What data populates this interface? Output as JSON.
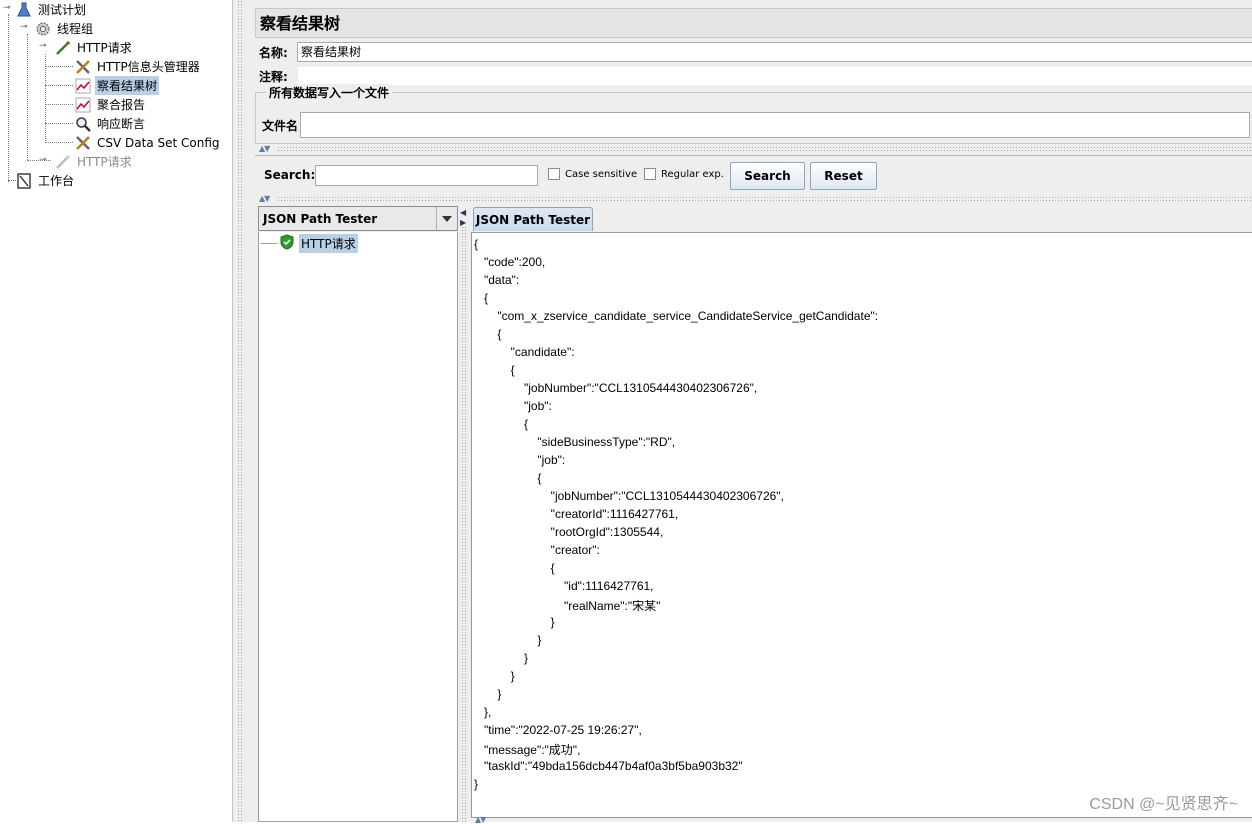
{
  "tree": {
    "nodes": [
      {
        "label": "测试计划",
        "icon": "flask-icon"
      },
      {
        "label": "线程组",
        "icon": "gear-icon"
      },
      {
        "label": "HTTP请求",
        "icon": "pipette-icon"
      },
      {
        "label": "HTTP信息头管理器",
        "icon": "wrench-icon"
      },
      {
        "label": "察看结果树",
        "icon": "graph-icon"
      },
      {
        "label": "聚合报告",
        "icon": "graph-icon"
      },
      {
        "label": "响应断言",
        "icon": "magnifier-icon"
      },
      {
        "label": "CSV Data Set Config",
        "icon": "wrench-icon"
      },
      {
        "label": "HTTP请求",
        "icon": "pipette-icon"
      },
      {
        "label": "工作台",
        "icon": "workbench-icon"
      }
    ]
  },
  "panel": {
    "title": "察看结果树",
    "name_label": "名称:",
    "name_value": "察看结果树",
    "comment_label": "注释:",
    "comment_value": "",
    "group_title": "所有数据写入一个文件",
    "filename_label": "文件名",
    "filename_value": ""
  },
  "search": {
    "label": "Search:",
    "value": "",
    "case_sensitive": "Case sensitive",
    "regular_exp": "Regular exp.",
    "search_button": "Search",
    "reset_button": "Reset"
  },
  "renderer": {
    "selected": "JSON Path Tester",
    "result_item": "HTTP请求",
    "tab_label": "JSON Path Tester"
  },
  "json_lines": [
    "{",
    "   \"code\":200,",
    "   \"data\":",
    "   {",
    "      \"com_x_zservice_candidate_service_CandidateService_getCandidate\":",
    "      {",
    "         \"candidate\":",
    "         {",
    "            \"jobNumber\":\"CCL1310544430402306726\",",
    "            \"job\":",
    "            {",
    "               \"sideBusinessType\":\"RD\",",
    "               \"job\":",
    "               {",
    "                  \"jobNumber\":\"CCL1310544430402306726\",",
    "                  \"creatorId\":1116427761,",
    "                  \"rootOrgId\":1305544,",
    "                  \"creator\":",
    "                  {",
    "                     \"id\":1116427761,",
    "                     \"realName\":\"宋某\"",
    "                  }",
    "               }",
    "            }",
    "         }",
    "      }",
    "   },",
    "   \"time\":\"2022-07-25 19:26:27\",",
    "   \"message\":\"成功\",",
    "   \"taskId\":\"49bda156dcb447b4af0a3bf5ba903b32\"",
    "}"
  ],
  "watermark": "CSDN @~见贤思齐~"
}
